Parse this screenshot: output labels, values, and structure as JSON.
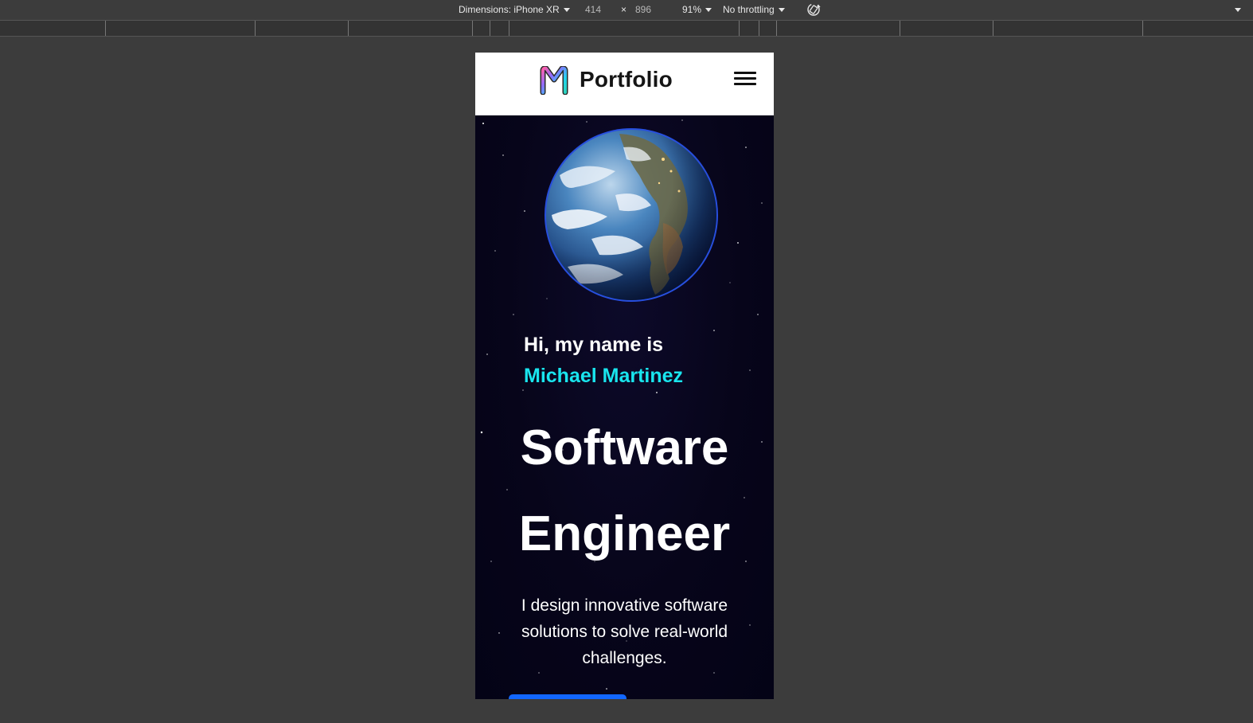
{
  "devtools": {
    "dimensions_label": "Dimensions: iPhone XR",
    "width": "414",
    "times": "×",
    "height": "896",
    "zoom": "91%",
    "throttling": "No throttling",
    "rotate_icon": "rotate-device-icon"
  },
  "site": {
    "brand": "Portfolio",
    "logo_icon": "m-logo-icon",
    "menu_icon": "hamburger-menu-icon",
    "greeting": "Hi, my name is",
    "name": "Michael Martinez",
    "role_line1": "Software",
    "role_line2": "Engineer",
    "description": "I design innovative software solutions to solve real-world challenges.",
    "globe_image": "earth-globe-image",
    "colors": {
      "accent": "#19e5ee",
      "button": "#1267ff",
      "hero_bg": "#07051a"
    }
  }
}
